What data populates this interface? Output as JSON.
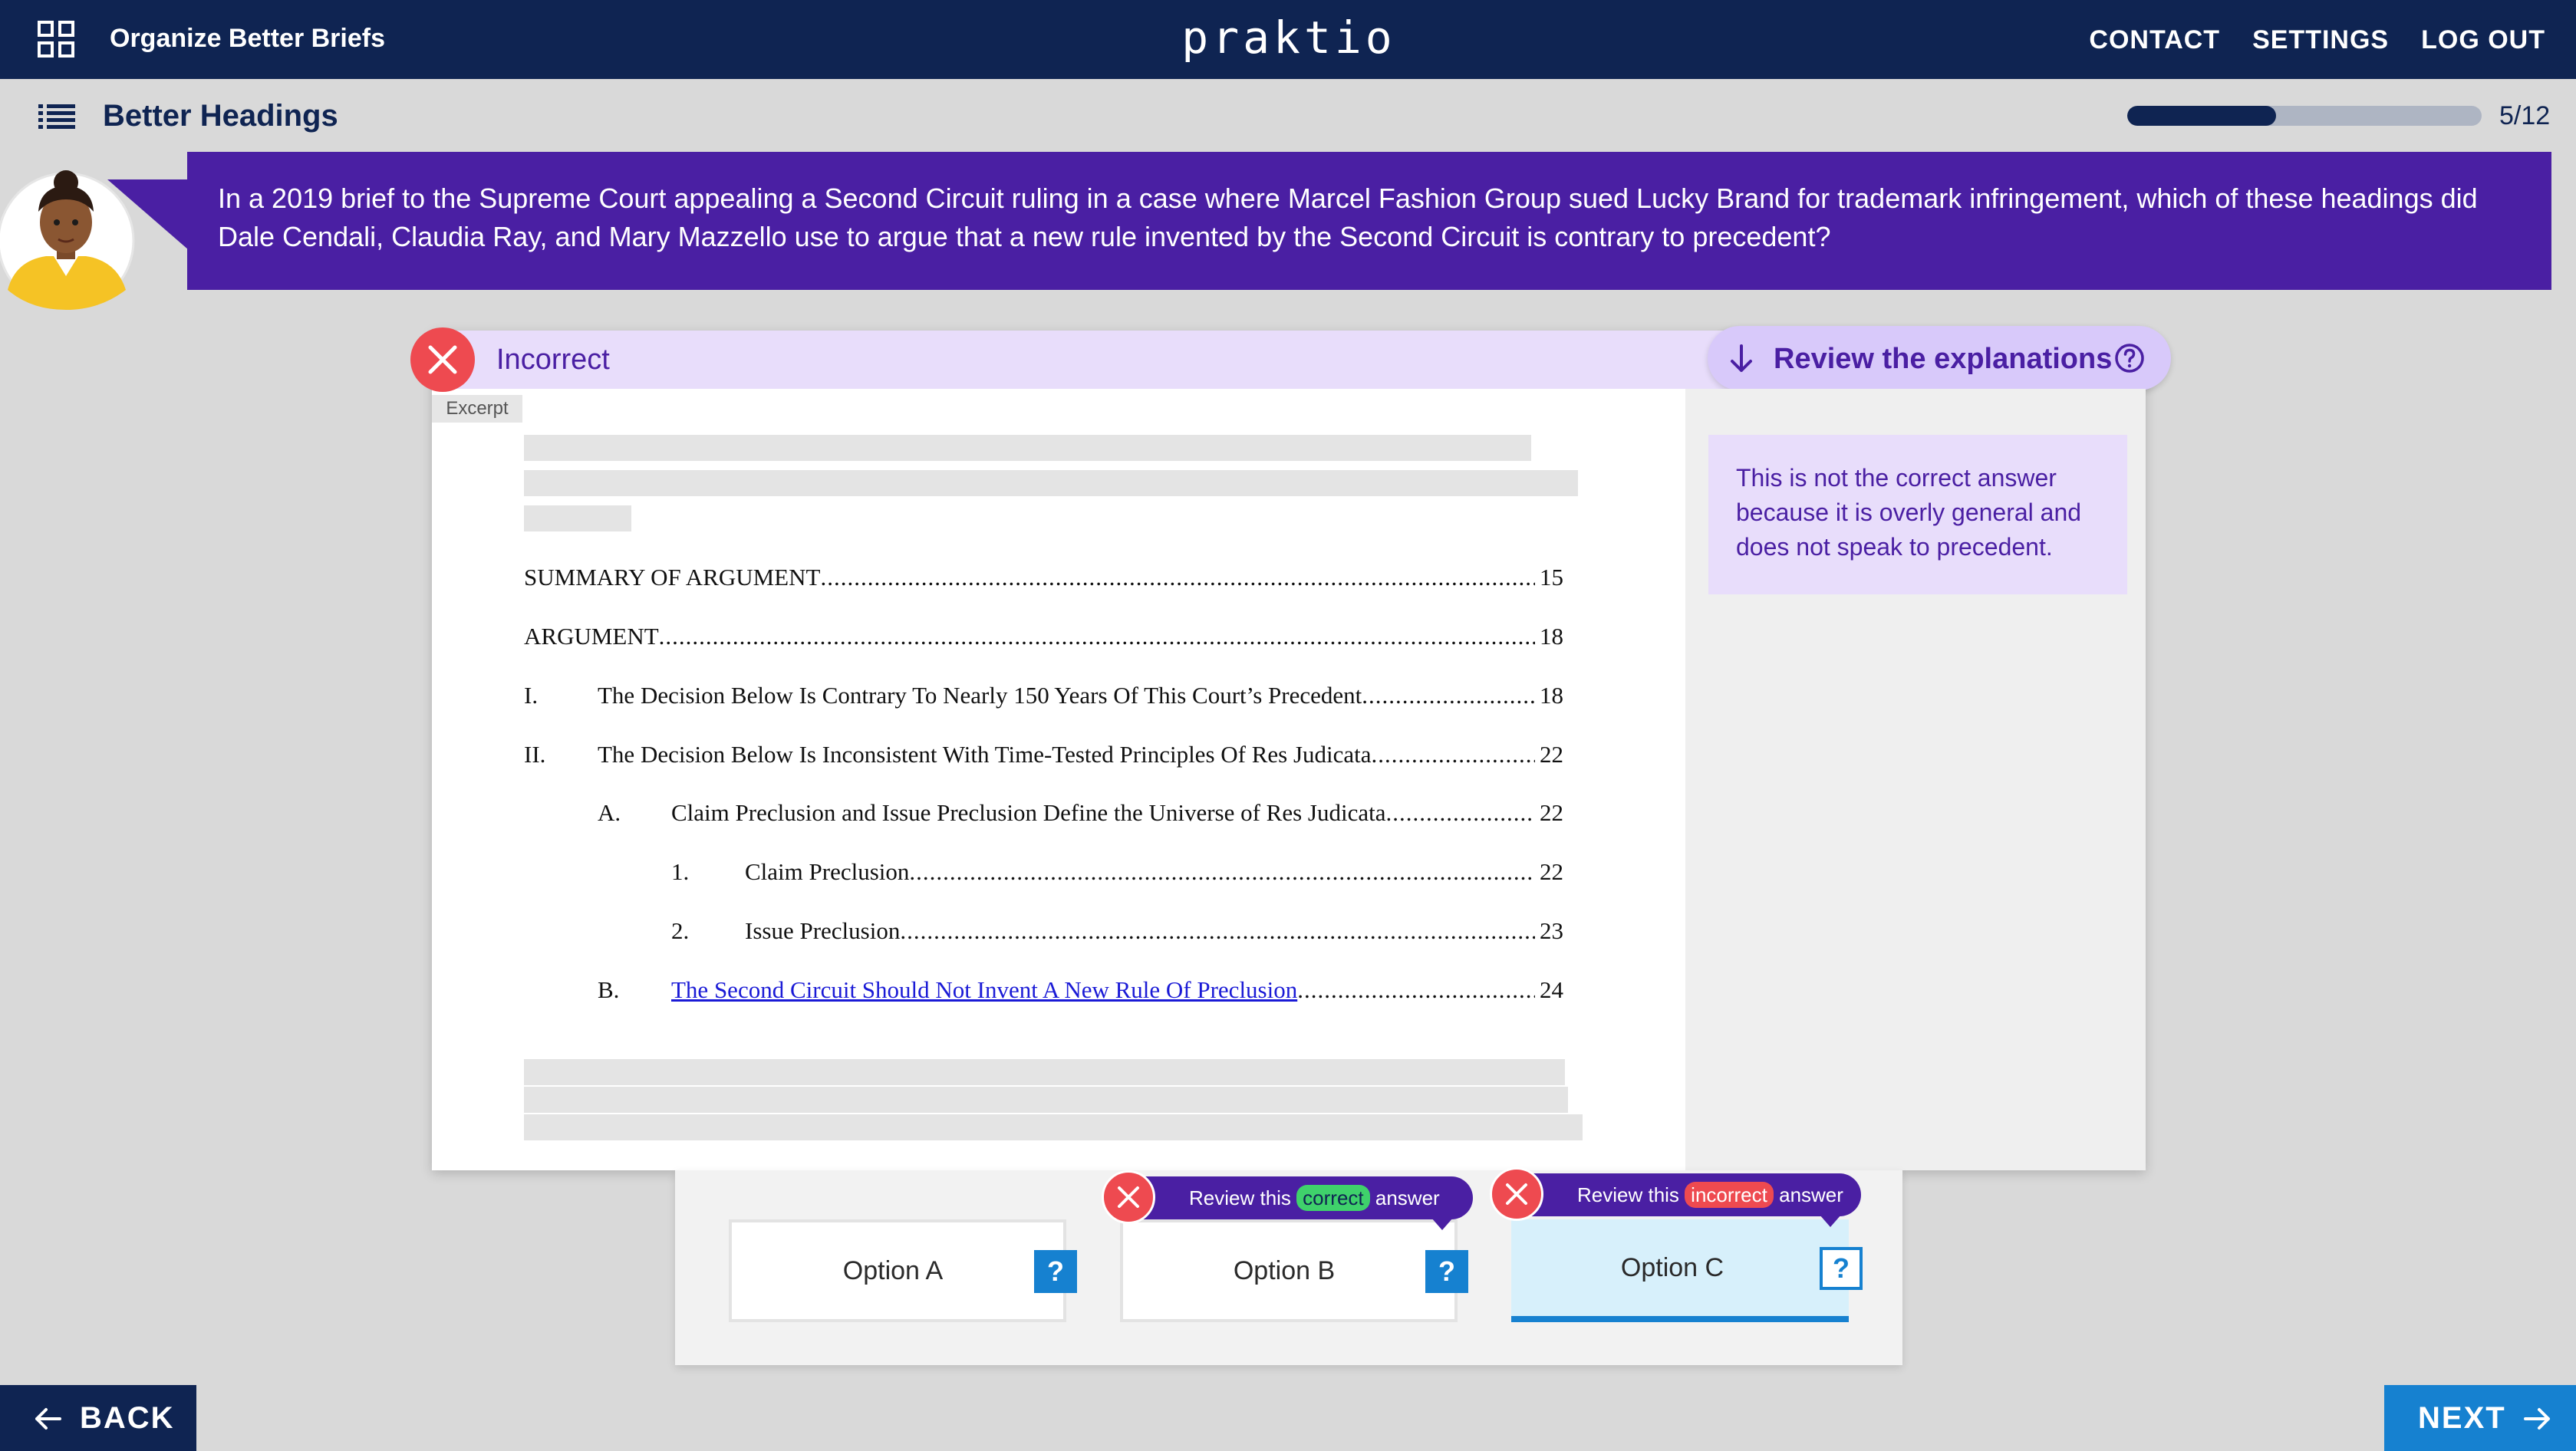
{
  "header": {
    "course_title": "Organize Better Briefs",
    "logo": "praktio",
    "nav": {
      "contact": "CONTACT",
      "settings": "SETTINGS",
      "logout": "LOG OUT"
    }
  },
  "lesson": {
    "title": "Better Headings",
    "progress_text": "5/12",
    "progress_fraction": 0.42
  },
  "question": {
    "text": "In a 2019 brief to the Supreme Court appealing a Second Circuit ruling in a case where Marcel Fashion Group sued Lucky Brand for trademark infringement, which of these headings did Dale Cendali, Claudia Ray, and Mary Mazzello use to argue that a new rule invented by the Second Circuit is contrary to precedent?"
  },
  "result": {
    "status": "Incorrect",
    "review_label": "Review the explanations"
  },
  "excerpt": {
    "tag": "Excerpt",
    "toc": [
      {
        "num": "",
        "text": "SUMMARY OF ARGUMENT",
        "page": "15"
      },
      {
        "num": "",
        "text": "ARGUMENT",
        "page": "18"
      },
      {
        "num": "I.",
        "text": "The Decision Below Is Contrary To Nearly 150 Years Of This Court’s Precedent",
        "page": "18"
      },
      {
        "num": "II.",
        "text": "The Decision Below Is Inconsistent With Time-Tested Principles Of Res Judicata",
        "page": "22"
      },
      {
        "num": "A.",
        "text": "Claim Preclusion and Issue Preclusion Define the Universe of Res Judicata",
        "page": "22"
      },
      {
        "num": "1.",
        "text": "Claim Preclusion",
        "page": "22"
      },
      {
        "num": "2.",
        "text": "Issue Preclusion",
        "page": "23"
      },
      {
        "num": "B.",
        "text": "The Second Circuit Should Not Invent A New Rule Of Preclusion",
        "page": "24"
      }
    ]
  },
  "explanation": {
    "text": "This is not the correct answer because it is overly general and does not speak to precedent."
  },
  "options": [
    {
      "label": "Option A",
      "help": "?"
    },
    {
      "label": "Option B",
      "help": "?",
      "review_prefix": "Review this",
      "review_word": "correct",
      "review_suffix": "answer"
    },
    {
      "label": "Option C",
      "help": "?",
      "review_prefix": "Review this",
      "review_word": "incorrect",
      "review_suffix": "answer"
    }
  ],
  "footer": {
    "back": "BACK",
    "next": "NEXT"
  },
  "colors": {
    "navy": "#0f2452",
    "purple": "#4a1fa3",
    "lavender": "#e8ddfb",
    "error_red": "#ee4a50",
    "correct_green": "#3fd16b",
    "accent_blue": "#1681d0"
  }
}
